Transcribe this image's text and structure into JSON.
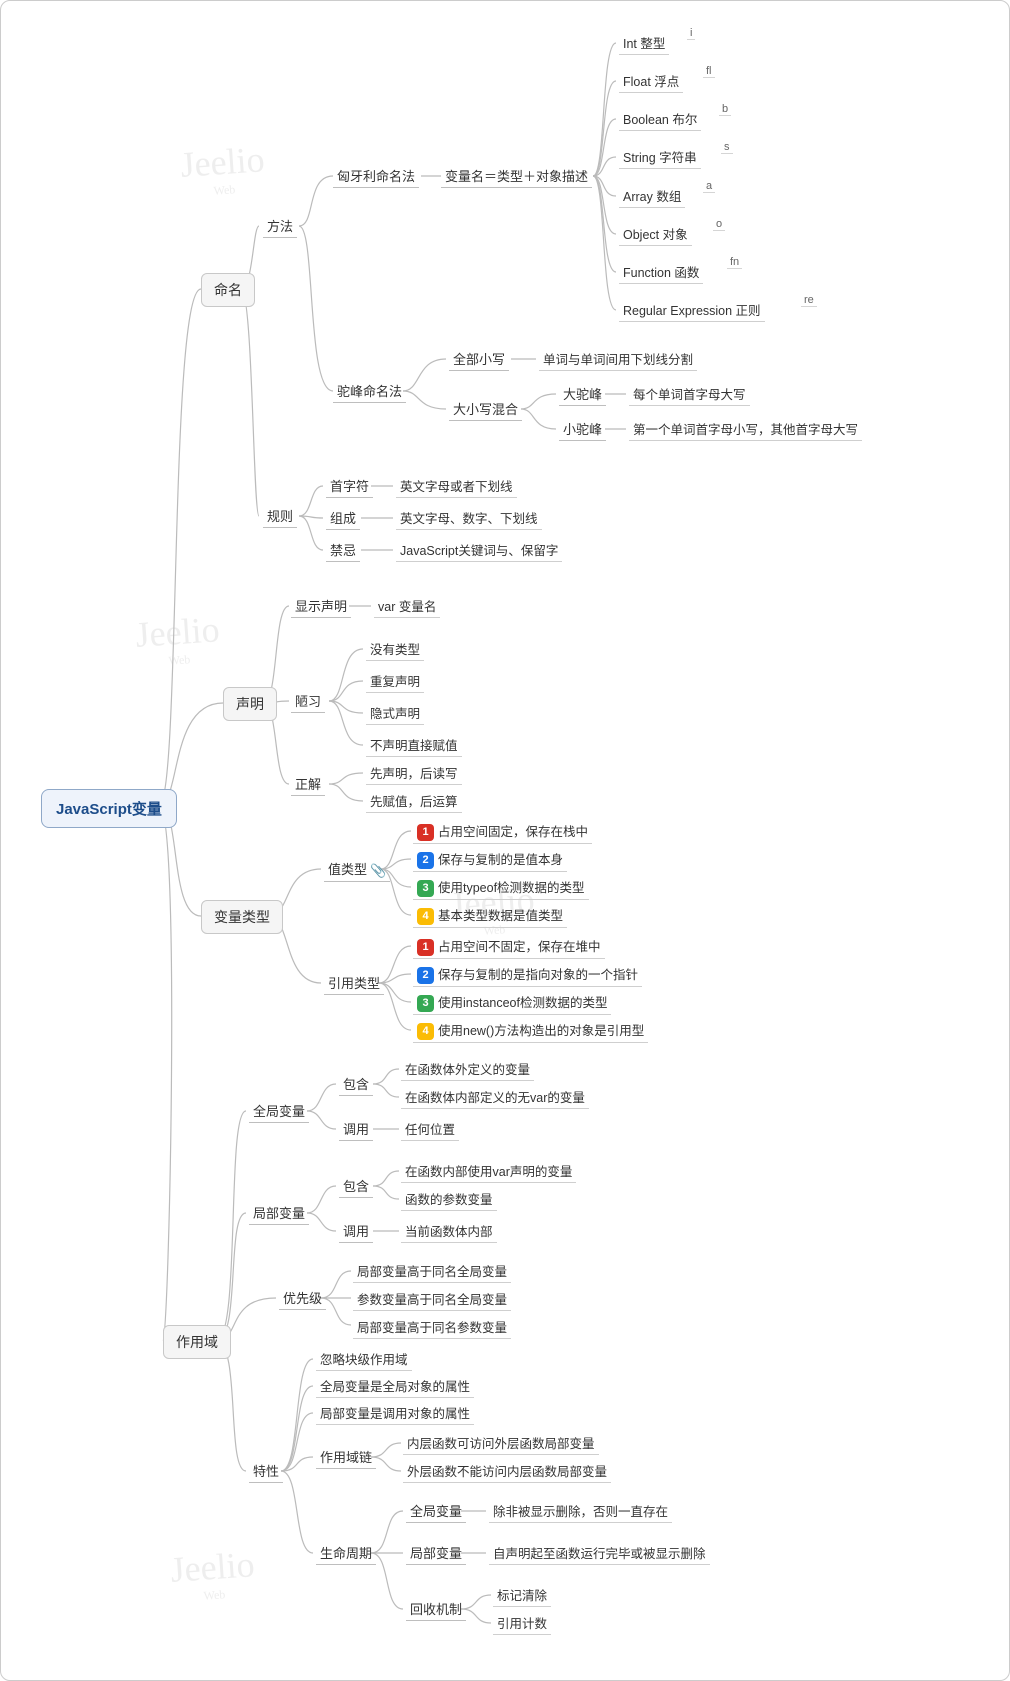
{
  "root": "JavaScript变量",
  "naming": {
    "title": "命名",
    "method": "方法",
    "hungarian": "匈牙利命名法",
    "varFormula": "变量名＝类型＋对象描述",
    "types": [
      {
        "label": "Int 整型",
        "tag": "i"
      },
      {
        "label": "Float 浮点",
        "tag": "fl"
      },
      {
        "label": "Boolean 布尔",
        "tag": "b"
      },
      {
        "label": "String 字符串",
        "tag": "s"
      },
      {
        "label": "Array 数组",
        "tag": "a"
      },
      {
        "label": "Object 对象",
        "tag": "o"
      },
      {
        "label": "Function 函数",
        "tag": "fn"
      },
      {
        "label": "Regular Expression 正则",
        "tag": "re"
      }
    ],
    "camel": "驼峰命名法",
    "allLower": "全部小写",
    "allLowerDesc": "单词与单词间用下划线分割",
    "mixedCase": "大小写混合",
    "bigCamel": "大驼峰",
    "bigCamelDesc": "每个单词首字母大写",
    "smallCamel": "小驼峰",
    "smallCamelDesc": "第一个单词首字母小写，其他首字母大写",
    "rule": "规则",
    "firstChar": "首字符",
    "firstCharDesc": "英文字母或者下划线",
    "compose": "组成",
    "composeDesc": "英文字母、数字、下划线",
    "forbid": "禁忌",
    "forbidDesc": "JavaScript关键词与、保留字"
  },
  "declare": {
    "title": "声明",
    "explicit": "显示声明",
    "explicitDesc": "var 变量名",
    "bad": "陋习",
    "badItems": [
      "没有类型",
      "重复声明",
      "隐式声明",
      "不声明直接赋值"
    ],
    "good": "正解",
    "goodItems": [
      "先声明，后读写",
      "先赋值，后运算"
    ]
  },
  "vartype": {
    "title": "变量类型",
    "value": "值类型",
    "valueItems": [
      "占用空间固定，保存在栈中",
      "保存与复制的是值本身",
      "使用typeof检测数据的类型",
      "基本类型数据是值类型"
    ],
    "ref": "引用类型",
    "refItems": [
      "占用空间不固定，保存在堆中",
      "保存与复制的是指向对象的一个指针",
      "使用instanceof检测数据的类型",
      "使用new()方法构造出的对象是引用型"
    ]
  },
  "scope": {
    "title": "作用域",
    "global": "全局变量",
    "include": "包含",
    "globalInc": [
      "在函数体外定义的变量",
      "在函数体内部定义的无var的变量"
    ],
    "call": "调用",
    "globalCall": "任何位置",
    "local": "局部变量",
    "localInc": [
      "在函数内部使用var声明的变量",
      "函数的参数变量"
    ],
    "localCall": "当前函数体内部",
    "priority": "优先级",
    "priorityItems": [
      "局部变量高于同名全局变量",
      "参数变量高于同名全局变量",
      "局部变量高于同名参数变量"
    ],
    "feature": "特性",
    "featureTop": [
      "忽略块级作用域",
      "全局变量是全局对象的属性",
      "局部变量是调用对象的属性"
    ],
    "chain": "作用域链",
    "chainItems": [
      "内层函数可访问外层函数局部变量",
      "外层函数不能访问内层函数局部变量"
    ],
    "life": "生命周期",
    "lifeGlobal": "全局变量",
    "lifeGlobalDesc": "除非被显示删除，否则一直存在",
    "lifeLocal": "局部变量",
    "lifeLocalDesc": "自声明起至函数运行完毕或被显示删除",
    "gc": "回收机制",
    "gcItems": [
      "标记清除",
      "引用计数"
    ]
  }
}
